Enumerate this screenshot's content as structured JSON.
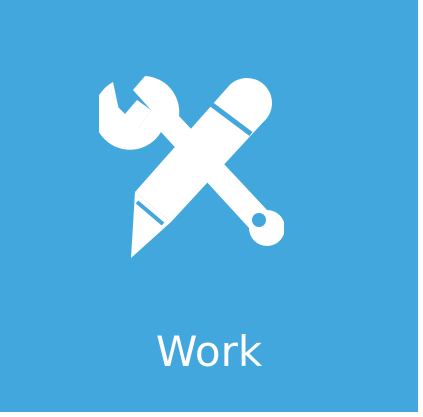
{
  "tile": {
    "label": "Work",
    "icon": "wrench-pencil-icon",
    "background_color": "#42a7dc",
    "foreground_color": "#ffffff"
  }
}
